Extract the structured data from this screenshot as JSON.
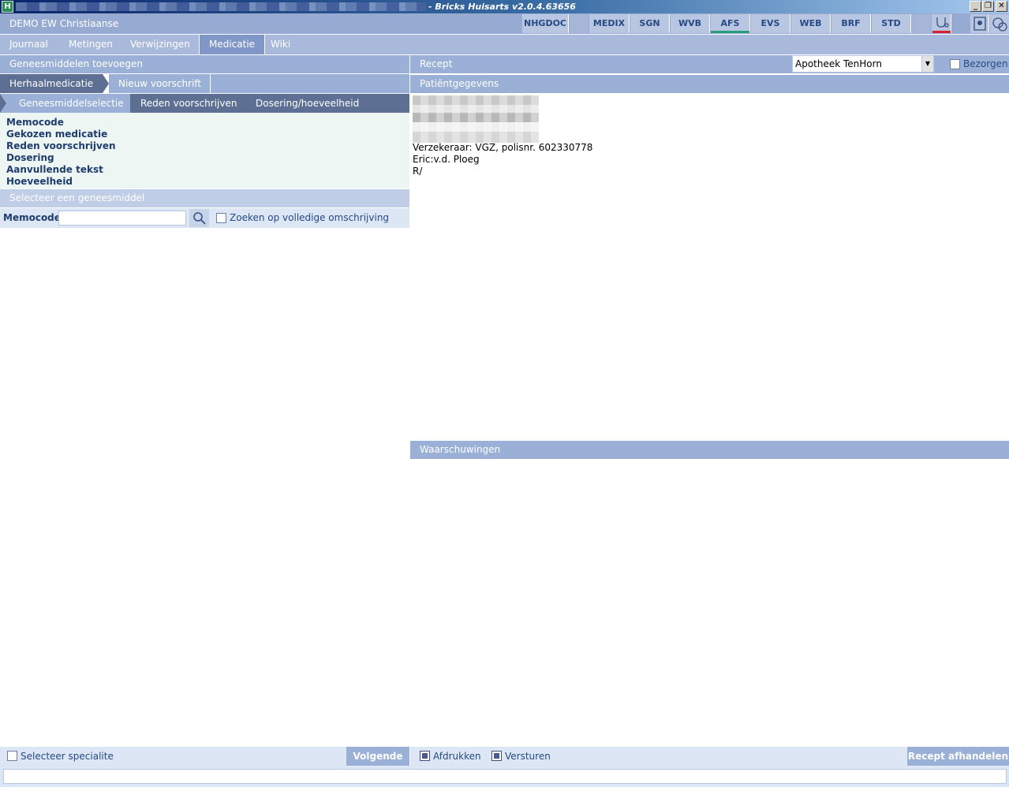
{
  "window": {
    "title": "- Bricks Huisarts v2.0.4.63656",
    "controls": {
      "minimize": "_",
      "restore": "❐",
      "close": "✕"
    }
  },
  "header": {
    "user_label": "DEMO  EW Christiaanse",
    "toolbar": [
      {
        "label": "NHGDOC"
      },
      {
        "label": "MEDIX"
      },
      {
        "label": "SGN"
      },
      {
        "label": "WVB"
      },
      {
        "label": "AFS",
        "underline_color": "#2a9d7c"
      },
      {
        "label": "EVS"
      },
      {
        "label": "WEB"
      },
      {
        "label": "BRF"
      },
      {
        "label": "STD"
      }
    ],
    "icon_buttons": [
      "stethoscope-icon",
      "contact-card-icon",
      "bubbles-icon"
    ],
    "stethoscope_underline_color": "#d9232e"
  },
  "nav": {
    "tabs": [
      "Journaal",
      "Metingen",
      "Verwijzingen",
      "Medicatie",
      "Wiki"
    ],
    "active": "Medicatie"
  },
  "left": {
    "section_title": "Geneesmiddelen toevoegen",
    "tabs1": [
      "Herhaalmedicatie",
      "Nieuw voorschrift"
    ],
    "tabs2": [
      "Geneesmiddelselectie",
      "Reden voorschrijven",
      "Dosering/hoeveelheid"
    ],
    "summary": [
      "Memocode",
      "Gekozen medicatie",
      "Reden voorschrijven",
      "Dosering",
      "Aanvullende tekst",
      "Hoeveelheid"
    ],
    "select_title": "Selecteer een geneesmiddel",
    "search": {
      "label": "Memocode",
      "value": "",
      "placeholder": "",
      "full_search_label": "Zoeken op volledige omschrijving"
    },
    "bottom": {
      "specialite_label": "Selecteer specialite",
      "next_label": "Volgende"
    }
  },
  "right": {
    "recept_title": "Recept",
    "pharmacy": "Apotheek TenHorn",
    "bezorgen_label": "Bezorgen",
    "patient_title": "Patiëntgegevens",
    "patient_lines": [
      "Verzekeraar: VGZ, polisnr. 602330778",
      "Eric:v.d. Ploeg",
      "R/"
    ],
    "warnings_title": "Waarschuwingen",
    "bottom": {
      "print_label": "Afdrukken",
      "send_label": "Versturen",
      "finish_label": "Recept afhandelen"
    }
  },
  "colors": {
    "header_bg": "#97aad2",
    "nav_bg": "#a9b9dc",
    "section_bg": "#9bb0d6",
    "tab_dark": "#5e6f94",
    "text_accent": "#274a84"
  }
}
